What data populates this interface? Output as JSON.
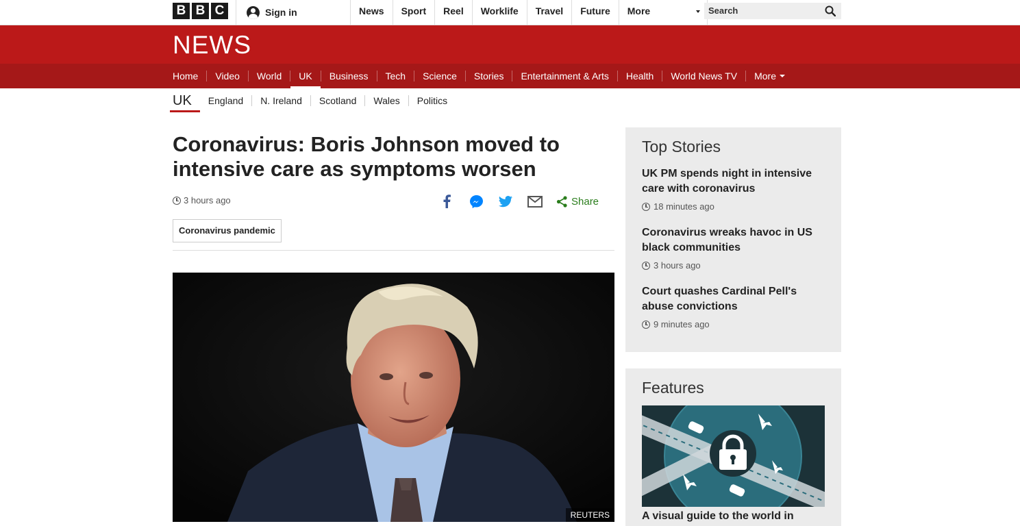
{
  "header": {
    "logo_letters": [
      "B",
      "B",
      "C"
    ],
    "signin_label": "Sign in",
    "nav": [
      "News",
      "Sport",
      "Reel",
      "Worklife",
      "Travel",
      "Future"
    ],
    "more_label": "More",
    "search_placeholder": "Search"
  },
  "masthead": {
    "title": "NEWS",
    "nav": [
      "Home",
      "Video",
      "World",
      "UK",
      "Business",
      "Tech",
      "Science",
      "Stories",
      "Entertainment & Arts",
      "Health",
      "World News TV"
    ],
    "more_label": "More",
    "active": "UK"
  },
  "subnav": {
    "home": "UK",
    "items": [
      "England",
      "N. Ireland",
      "Scotland",
      "Wales",
      "Politics"
    ]
  },
  "article": {
    "headline": "Coronavirus: Boris Johnson moved to intensive care as symptoms worsen",
    "time": "3 hours ago",
    "share_label": "Share",
    "share_icons": [
      "facebook-icon",
      "messenger-icon",
      "twitter-icon",
      "email-icon",
      "share-icon"
    ],
    "tag": "Coronavirus pandemic",
    "image_credit": "REUTERS"
  },
  "top_stories": {
    "title": "Top Stories",
    "items": [
      {
        "title": "UK PM spends night in intensive care with coronavirus",
        "time": "18 minutes ago"
      },
      {
        "title": "Coronavirus wreaks havoc in US black communities",
        "time": "3 hours ago"
      },
      {
        "title": "Court quashes Cardinal Pell's abuse convictions",
        "time": "9 minutes ago"
      }
    ]
  },
  "features": {
    "title": "Features",
    "item_title": "A visual guide to the world in"
  },
  "colors": {
    "brand_red": "#bb1919",
    "nav_red": "#a51818",
    "share_green": "#2a7d1c"
  }
}
